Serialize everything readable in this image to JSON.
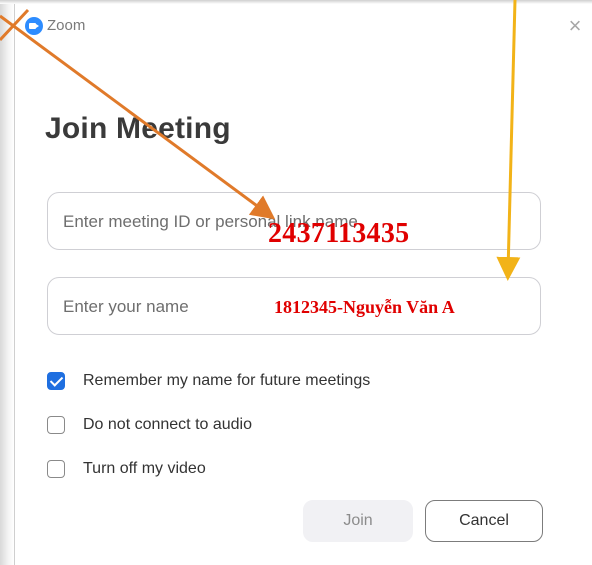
{
  "window": {
    "app_title": "Zoom",
    "close_glyph": "×"
  },
  "heading": "Join Meeting",
  "meeting_id_field": {
    "placeholder": "Enter meeting ID or personal link name",
    "overlay_value": "2437113435"
  },
  "name_field": {
    "placeholder": "Enter your name",
    "overlay_value": "1812345-Nguyễn Văn A"
  },
  "options": [
    {
      "label": "Remember my name for future meetings",
      "checked": true
    },
    {
      "label": "Do not connect to audio",
      "checked": false
    },
    {
      "label": "Turn off my video",
      "checked": false
    }
  ],
  "buttons": {
    "join_label": "Join",
    "cancel_label": "Cancel"
  },
  "colors": {
    "accent": "#1f6fe0",
    "overlay_text": "#e00000",
    "arrow_orange": "#e07a2a",
    "arrow_yellow": "#f2b318"
  },
  "icons": {
    "app_logo": "zoom-camera-icon",
    "close": "close-icon",
    "check": "checkmark-icon"
  }
}
